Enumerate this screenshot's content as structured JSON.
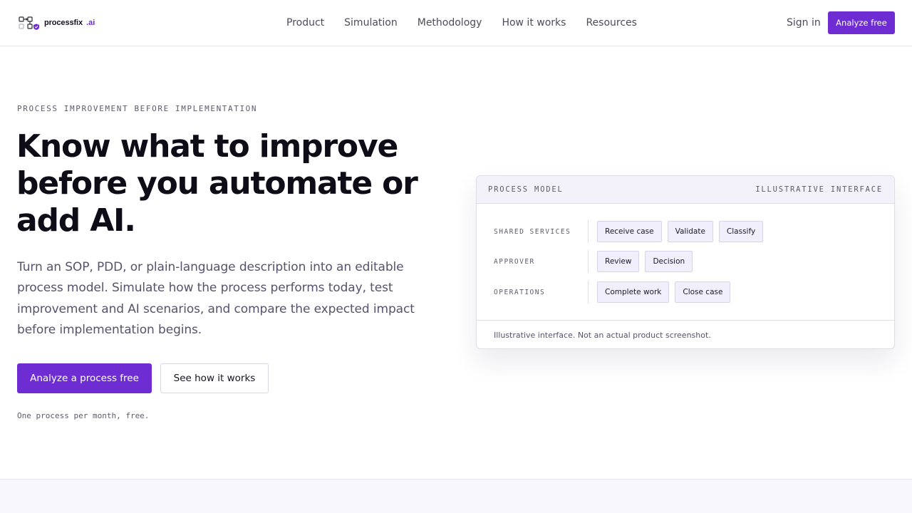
{
  "nav": {
    "brand_name": "processfix",
    "brand_tld": ".ai",
    "links": [
      "Product",
      "Simulation",
      "Methodology",
      "How it works",
      "Resources"
    ],
    "sign_in": "Sign in",
    "cta": "Analyze free"
  },
  "hero": {
    "eyebrow": "PROCESS IMPROVEMENT BEFORE IMPLEMENTATION",
    "headline": "Know what to improve before you automate or add AI.",
    "lede": "Turn an SOP, PDD, or plain-language description into an editable process model. Simulate how the process performs today, test improvement and AI scenarios, and compare the expected impact before implementation begins.",
    "primary_cta": "Analyze a process free",
    "secondary_cta": "See how it works",
    "note": "One process per month, free."
  },
  "card": {
    "title": "PROCESS MODEL",
    "tag": "ILLUSTRATIVE INTERFACE",
    "lanes": [
      {
        "label": "SHARED SERVICES",
        "steps": [
          "Receive case",
          "Validate",
          "Classify"
        ]
      },
      {
        "label": "APPROVER",
        "steps": [
          "Review",
          "Decision"
        ]
      },
      {
        "label": "OPERATIONS",
        "steps": [
          "Complete work",
          "Close case"
        ]
      }
    ],
    "footer": "Illustrative interface. Not an actual product screenshot."
  },
  "colors": {
    "accent": "#6d2dd3",
    "text": "#0e0c17",
    "muted": "#55536a",
    "chip_bg": "#f0effb"
  }
}
